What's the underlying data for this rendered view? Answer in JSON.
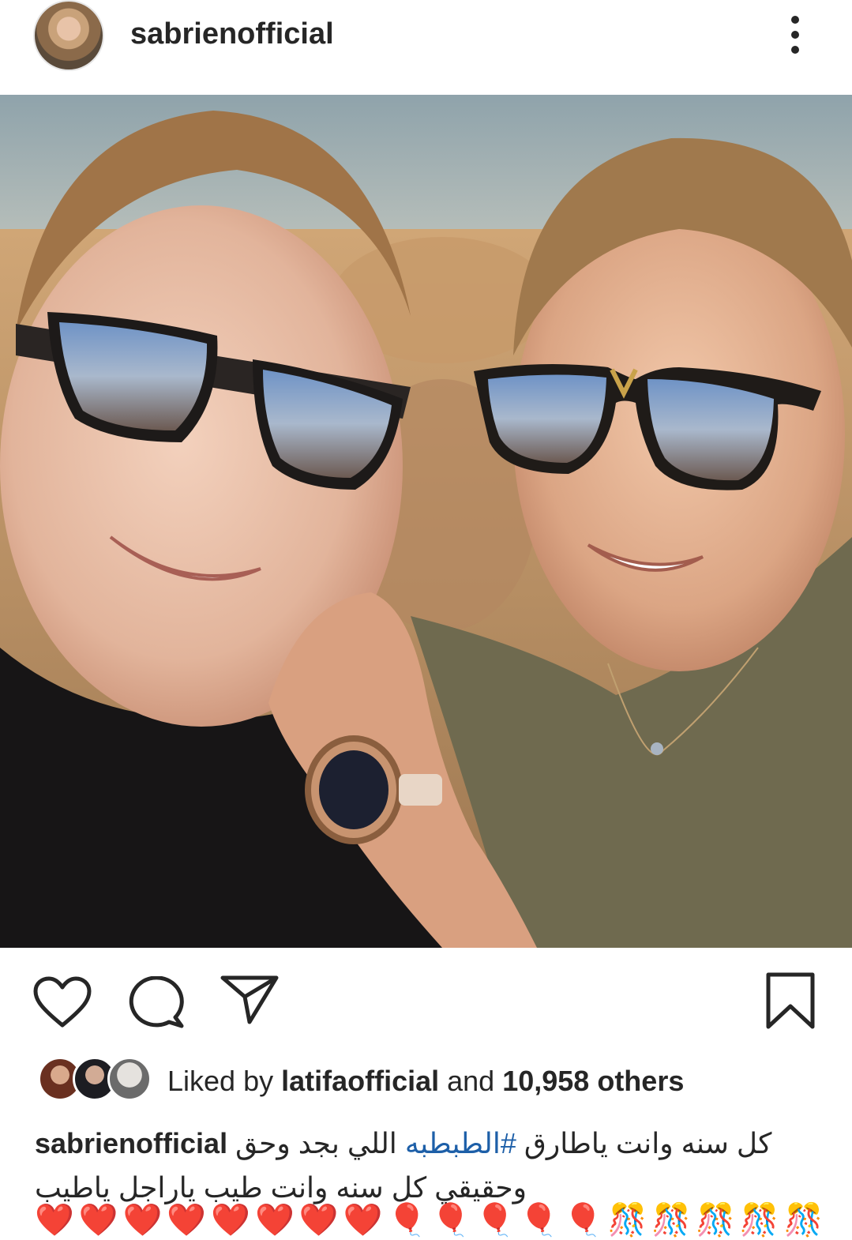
{
  "header": {
    "username": "sabrienofficial",
    "more_icon": "more-vertical-icon"
  },
  "post": {
    "image_alt": "Selfie of a smiling man and woman wearing mirrored sunglasses by the sea"
  },
  "actions": {
    "like_icon": "heart-icon",
    "comment_icon": "comment-icon",
    "share_icon": "send-icon",
    "save_icon": "bookmark-icon"
  },
  "likes": {
    "prefix": "Liked by ",
    "first_liker": "latifaofficial",
    "joiner": " and ",
    "others": "10,958 others"
  },
  "caption": {
    "username": "sabrienofficial",
    "text_part1": "كل سنه وانت ياطارق ",
    "hashtag": "#الطبطبه",
    "text_part2": " اللي بجد وحق",
    "line2": "وحقيقي كل سنه وانت طيب ياراجل ياطيب",
    "emoji_line": "❤️❤️❤️❤️❤️❤️❤️❤️🎈🎈🎈🎈🎈🎊🎊🎊🎊🎊"
  }
}
